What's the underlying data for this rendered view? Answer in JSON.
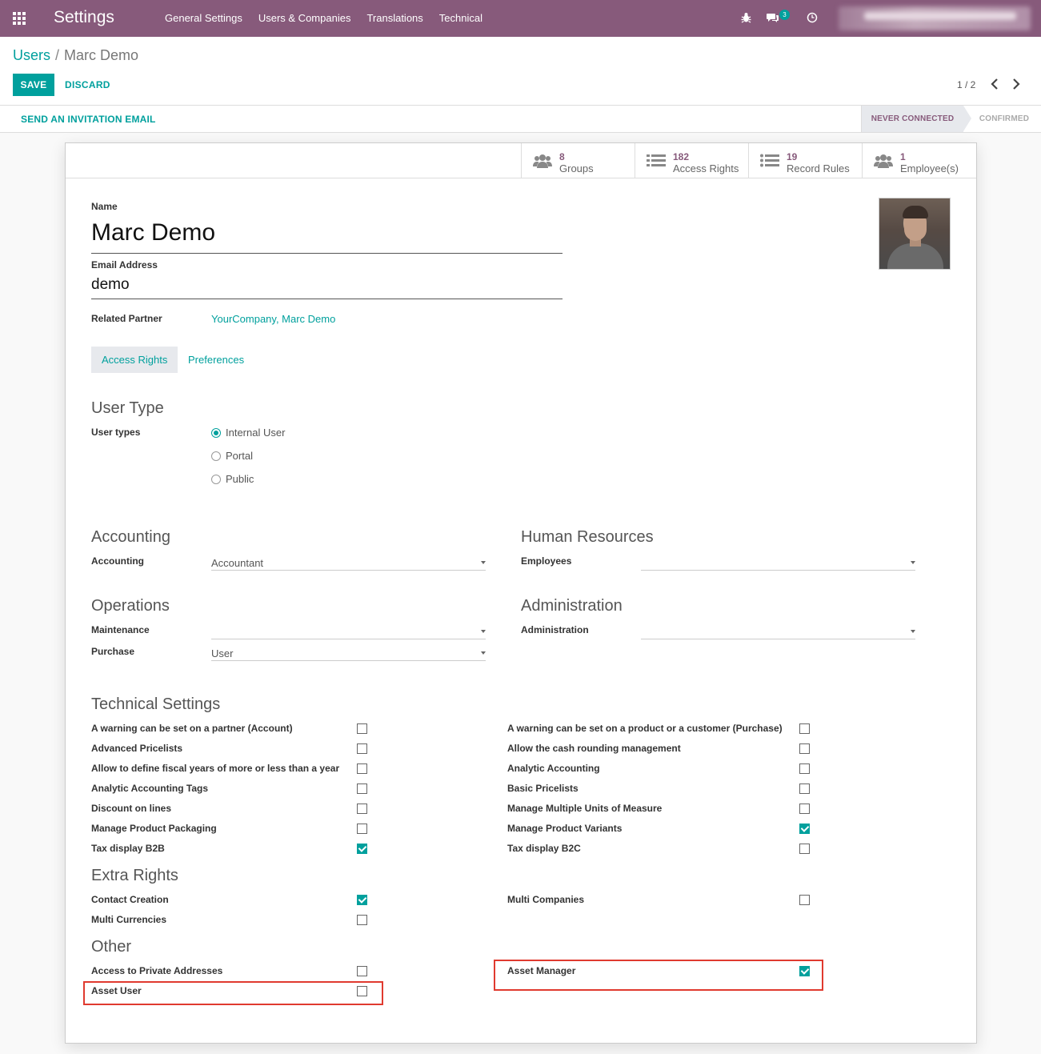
{
  "navbar": {
    "app_title": "Settings",
    "menu": [
      "General Settings",
      "Users & Companies",
      "Translations",
      "Technical"
    ],
    "messages_count": "3",
    "icons": [
      "apps-icon",
      "bug-icon",
      "chat-icon",
      "clock-icon"
    ],
    "accent_color": "#875a7b"
  },
  "breadcrumb": {
    "parent": "Users",
    "separator": "/",
    "current": "Marc Demo"
  },
  "control": {
    "save_label": "SAVE",
    "discard_label": "DISCARD",
    "pager": "1 / 2"
  },
  "statusbar": {
    "invite_label": "SEND AN INVITATION EMAIL",
    "stages": [
      "NEVER CONNECTED",
      "CONFIRMED"
    ],
    "active_stage": "NEVER CONNECTED"
  },
  "smart_buttons": [
    {
      "value": "8",
      "label": "Groups",
      "icon": "users-icon"
    },
    {
      "value": "182",
      "label": "Access Rights",
      "icon": "list-icon"
    },
    {
      "value": "19",
      "label": "Record Rules",
      "icon": "list-icon"
    },
    {
      "value": "1",
      "label": "Employee(s)",
      "icon": "users-icon"
    }
  ],
  "form": {
    "name_label": "Name",
    "name_value": "Marc Demo",
    "email_label": "Email Address",
    "email_value": "demo",
    "partner_label": "Related Partner",
    "partner_value": "YourCompany, Marc Demo"
  },
  "tabs": [
    "Access Rights",
    "Preferences"
  ],
  "user_type": {
    "title": "User Type",
    "label": "User types",
    "options": [
      "Internal User",
      "Portal",
      "Public"
    ],
    "selected": "Internal User"
  },
  "apps": {
    "accounting": {
      "title": "Accounting",
      "label": "Accounting",
      "value": "Accountant"
    },
    "hr": {
      "title": "Human Resources",
      "label": "Employees",
      "value": ""
    },
    "operations": {
      "title": "Operations",
      "maintenance_label": "Maintenance",
      "maintenance_value": "",
      "purchase_label": "Purchase",
      "purchase_value": "User"
    },
    "administration": {
      "title": "Administration",
      "label": "Administration",
      "value": ""
    }
  },
  "technical": {
    "title": "Technical Settings",
    "left": [
      {
        "label": "A warning can be set on a partner (Account)",
        "checked": false
      },
      {
        "label": "Advanced Pricelists",
        "checked": false
      },
      {
        "label": "Allow to define fiscal years of more or less than a year",
        "checked": false
      },
      {
        "label": "Analytic Accounting Tags",
        "checked": false
      },
      {
        "label": "Discount on lines",
        "checked": false
      },
      {
        "label": "Manage Product Packaging",
        "checked": false
      },
      {
        "label": "Tax display B2B",
        "checked": true
      }
    ],
    "right": [
      {
        "label": "A warning can be set on a product or a customer (Purchase)",
        "checked": false
      },
      {
        "label": "Allow the cash rounding management",
        "checked": false
      },
      {
        "label": "Analytic Accounting",
        "checked": false
      },
      {
        "label": "Basic Pricelists",
        "checked": false
      },
      {
        "label": "Manage Multiple Units of Measure",
        "checked": false
      },
      {
        "label": "Manage Product Variants",
        "checked": true
      },
      {
        "label": "Tax display B2C",
        "checked": false
      }
    ]
  },
  "extra": {
    "title": "Extra Rights",
    "left": [
      {
        "label": "Contact Creation",
        "checked": true
      },
      {
        "label": "Multi Currencies",
        "checked": false
      }
    ],
    "right": [
      {
        "label": "Multi Companies",
        "checked": false
      }
    ]
  },
  "other": {
    "title": "Other",
    "left": [
      {
        "label": "Access to Private Addresses",
        "checked": false
      },
      {
        "label": "Asset User",
        "checked": false
      }
    ],
    "right": [
      {
        "label": "Asset Manager",
        "checked": true
      }
    ]
  }
}
